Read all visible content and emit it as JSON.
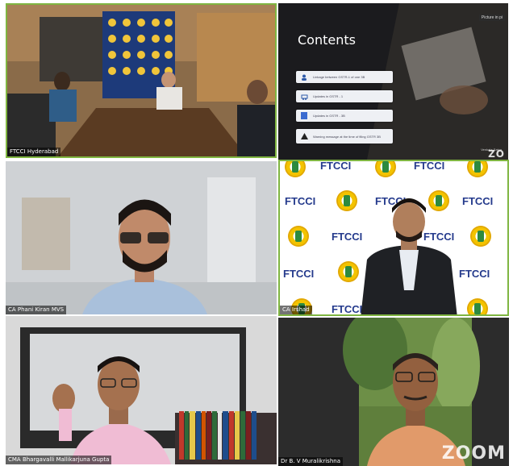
{
  "tiles": {
    "hyderabad": {
      "name": "FTCCI Hyderabad"
    },
    "slide": {
      "title": "Contents",
      "side_label": "Picture in pi",
      "items": [
        {
          "icon": "user-icon",
          "text": "Linkage between GSTR-1 of one 3B"
        },
        {
          "icon": "car-icon",
          "text": "Updates in GSTR - 1"
        },
        {
          "icon": "document-icon",
          "text": "Updates in GSTR - 3B"
        },
        {
          "icon": "warning-icon",
          "text": "Warning message at the time of filing GSTR 3B"
        }
      ],
      "presenter": "Venkata Satya",
      "brand": "ZO"
    },
    "phani": {
      "name": "CA Phani Kiran MVS"
    },
    "speaker": {
      "name": "CA Irshad",
      "backdrop_word": "FTCCI"
    },
    "bhargavalli": {
      "name": "CMA Bhargavalli Mallikarjuna Gupta"
    },
    "murali": {
      "name": "Dr B. V Muralikrishna",
      "brand": "ZOOM"
    }
  },
  "colors": {
    "active_border": "#7fb541",
    "ftcci_blue": "#243a8c",
    "ftcci_gold": "#f3c300"
  }
}
